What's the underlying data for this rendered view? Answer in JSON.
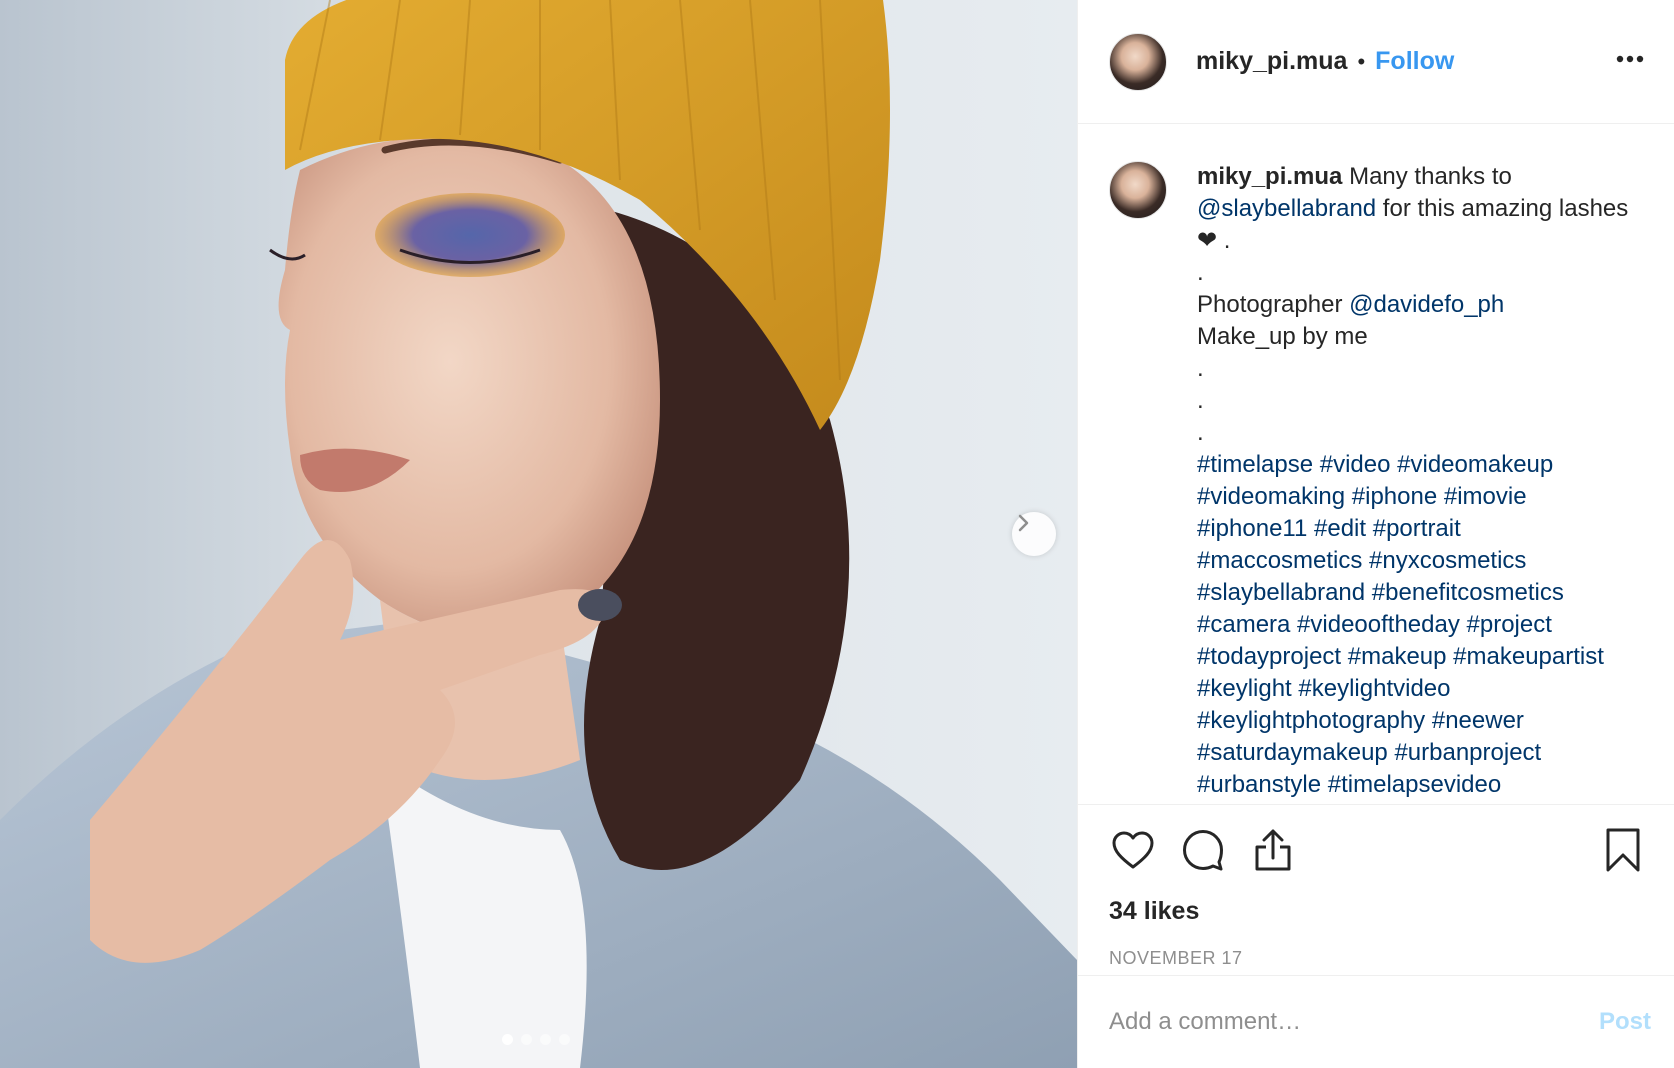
{
  "header": {
    "username": "miky_pi.mua",
    "separator": "•",
    "follow_label": "Follow"
  },
  "caption": {
    "username": "miky_pi.mua",
    "lines": [
      {
        "text": "Many thanks to"
      },
      {
        "mention": "@slaybellabrand",
        "text": " for this amazing lashes"
      },
      {
        "text": "❤ ."
      },
      {
        "text": "."
      },
      {
        "text": "Photographer ",
        "mention": "@davidefo_ph"
      },
      {
        "text": "Make_up by me"
      },
      {
        "text": "."
      },
      {
        "text": "."
      },
      {
        "text": "."
      }
    ],
    "hashtag_lines": [
      [
        "#timelapse",
        "#video",
        "#videomakeup"
      ],
      [
        "#videomaking",
        "#iphone",
        "#imovie"
      ],
      [
        "#iphone11",
        "#edit",
        "#portrait"
      ],
      [
        "#maccosmetics",
        "#nyxcosmetics"
      ],
      [
        "#slaybellabrand",
        "#benefitcosmetics"
      ],
      [
        "#camera",
        "#videooftheday",
        "#project"
      ],
      [
        "#todayproject",
        "#makeup",
        "#makeupartist"
      ],
      [
        "#keylight",
        "#keylightvideo"
      ],
      [
        "#keylightphotography",
        "#neewer"
      ],
      [
        "#saturdaymakeup",
        "#urbanproject"
      ],
      [
        "#urbanstyle",
        "#timelapsevideo"
      ]
    ]
  },
  "actions": {
    "like_icon": "heart-icon",
    "comment_icon": "comment-icon",
    "share_icon": "share-icon",
    "save_icon": "bookmark-icon"
  },
  "likes_text": "34 likes",
  "date_text": "NOVEMBER 17",
  "comment": {
    "placeholder": "Add a comment…",
    "post_label": "Post"
  },
  "carousel": {
    "slide_count": 4,
    "active_index": 0
  },
  "colors": {
    "link_blue": "#3897f0",
    "tag_navy": "#003569",
    "muted_gray": "#8e8e8e",
    "post_disabled": "#b2dffc"
  }
}
